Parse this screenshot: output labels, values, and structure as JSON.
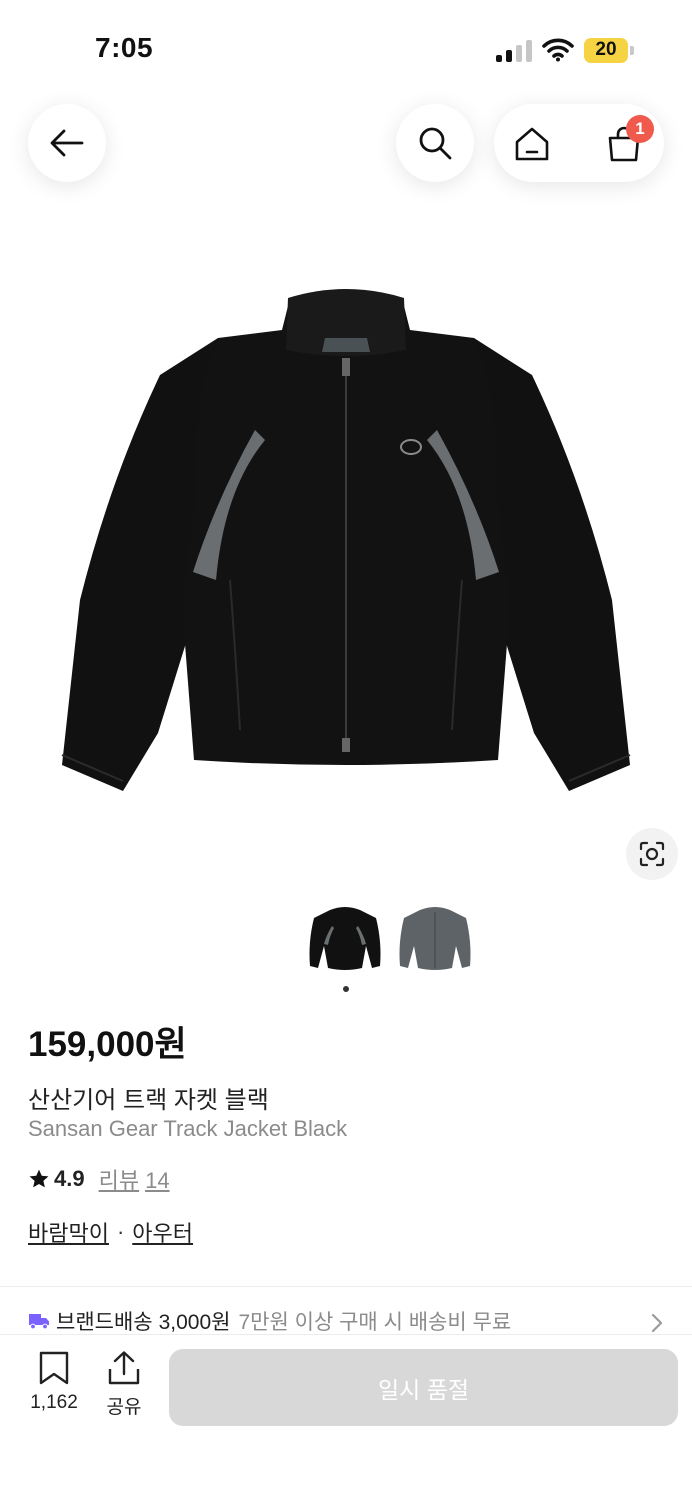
{
  "status_bar": {
    "time": "7:05",
    "battery": "20"
  },
  "header": {
    "cart_count": "1"
  },
  "product": {
    "price": "159,000원",
    "name_ko": "산산기어 트랙 자켓 블랙",
    "name_en": "Sansan Gear Track Jacket Black",
    "rating": "4.9",
    "review_label": "리뷰",
    "review_count": "14",
    "categories": [
      "바람막이",
      "아우터"
    ],
    "category_separator": "·"
  },
  "gallery": {
    "thumbnail_count": 2,
    "active_index": 0
  },
  "shipping": {
    "label": "브랜드배송",
    "fee": "3,000원",
    "note": "7만원 이상 구매 시 배송비 무료"
  },
  "bottom_bar": {
    "save_count": "1,162",
    "share_label": "공유",
    "buy_button_label": "일시 품절"
  },
  "colors": {
    "accent_badge": "#ef5a4d",
    "shipping_icon": "#7b61ff",
    "disabled_button": "#d8d8d8",
    "jacket_black": "#111111",
    "jacket_gray": "#5d6366"
  },
  "icons": [
    "back-arrow-icon",
    "search-icon",
    "home-icon",
    "shopping-bag-icon",
    "lens-search-icon",
    "star-icon",
    "truck-icon",
    "chevron-right-icon",
    "bookmark-icon",
    "share-icon"
  ]
}
